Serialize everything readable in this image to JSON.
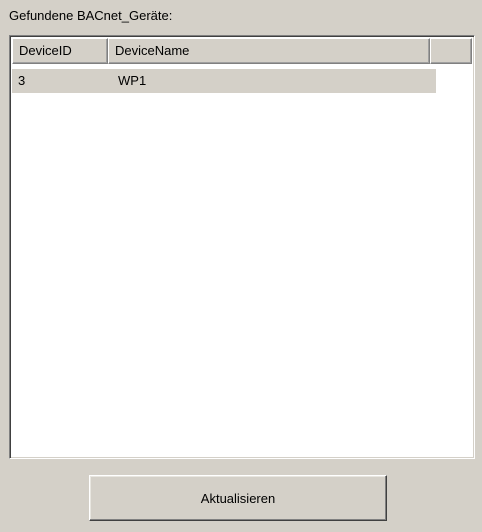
{
  "panel": {
    "label": "Gefundene BACnet_Geräte:"
  },
  "table": {
    "columns": [
      "DeviceID",
      "DeviceName"
    ],
    "rows": [
      {
        "device_id": "3",
        "device_name": "WP1"
      }
    ]
  },
  "actions": {
    "refresh_label": "Aktualisieren"
  },
  "colors": {
    "window_background": "#d4d0c8",
    "list_background": "#ffffff",
    "row_highlight": "#d4d0c8"
  }
}
